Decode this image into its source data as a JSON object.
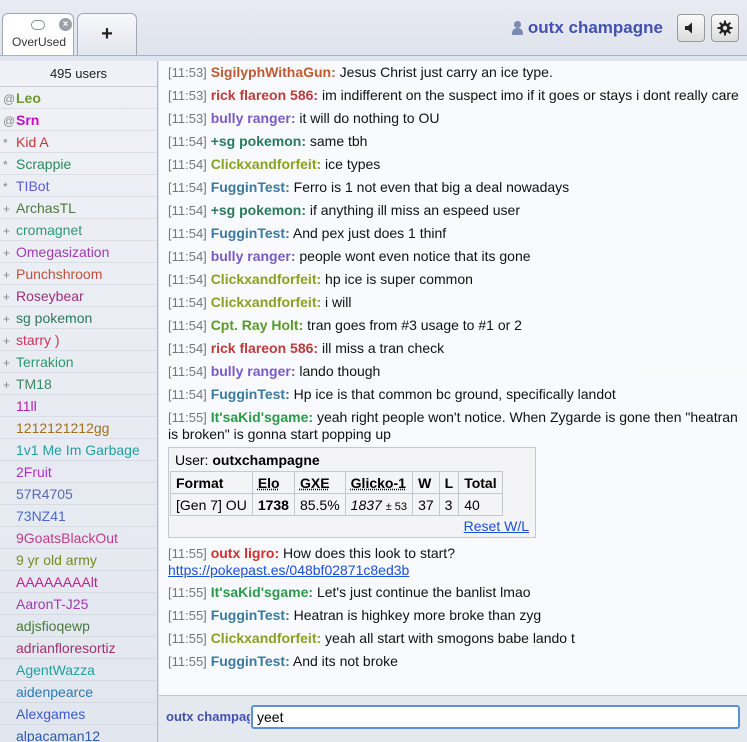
{
  "tabs": {
    "room_label": "OverUsed",
    "close_glyph": "×",
    "new_tab_glyph": "+"
  },
  "userbar": {
    "username": "outx champagne",
    "mute_icon": "speaker-icon",
    "settings_icon": "gear-icon"
  },
  "userlist": {
    "count_label": "495 users",
    "users": [
      {
        "rank": "@",
        "name": "Leo",
        "color": "#6a9a2a",
        "bold": true
      },
      {
        "rank": "@",
        "name": "Srn",
        "color": "#c010c0",
        "bold": true
      },
      {
        "rank": "*",
        "name": "Kid A",
        "color": "#c03838"
      },
      {
        "rank": "*",
        "name": "Scrappie",
        "color": "#2a8a5a"
      },
      {
        "rank": "*",
        "name": "TIBot",
        "color": "#5a5ad8"
      },
      {
        "rank": "+",
        "name": "ArchasTL",
        "color": "#4a7a3a"
      },
      {
        "rank": "+",
        "name": "cromagnet",
        "color": "#2a9a7a"
      },
      {
        "rank": "+",
        "name": "Omegasization",
        "color": "#a03ab0"
      },
      {
        "rank": "+",
        "name": "Punchshroom",
        "color": "#c0503a"
      },
      {
        "rank": "+",
        "name": "Roseybear",
        "color": "#a0307a"
      },
      {
        "rank": "+",
        "name": "sg pokemon",
        "color": "#2a7a5a"
      },
      {
        "rank": "+",
        "name": "starry )",
        "color": "#d0305a"
      },
      {
        "rank": "+",
        "name": "Terrakion",
        "color": "#2a9a6a"
      },
      {
        "rank": "+",
        "name": "TM18",
        "color": "#3a8a5a"
      },
      {
        "rank": "",
        "name": "11ll",
        "color": "#b020b0"
      },
      {
        "rank": "",
        "name": "1212121212gg",
        "color": "#a07020"
      },
      {
        "rank": "",
        "name": "1v1 Me Im Garbage",
        "color": "#20a0a0"
      },
      {
        "rank": "",
        "name": "2Fruit",
        "color": "#b030c0"
      },
      {
        "rank": "",
        "name": "57R4705",
        "color": "#5a6ab0"
      },
      {
        "rank": "",
        "name": "73NZ41",
        "color": "#4a6ad0"
      },
      {
        "rank": "",
        "name": "9GoatsBlackOut",
        "color": "#c03a8a"
      },
      {
        "rank": "",
        "name": "9 yr old army",
        "color": "#7a8a20"
      },
      {
        "rank": "",
        "name": "AAAAAAAAlt",
        "color": "#c02090"
      },
      {
        "rank": "",
        "name": "AaronT-J25",
        "color": "#a03ab0"
      },
      {
        "rank": "",
        "name": "adjsfioqewp",
        "color": "#4a7a3a"
      },
      {
        "rank": "",
        "name": "adrianfloresortiz",
        "color": "#a03070"
      },
      {
        "rank": "",
        "name": "AgentWazza",
        "color": "#20a0a0"
      },
      {
        "rank": "",
        "name": "aidenpearce",
        "color": "#2a7ab0"
      },
      {
        "rank": "",
        "name": "Alexgames",
        "color": "#3a5ad0"
      },
      {
        "rank": "",
        "name": "alpacaman12",
        "color": "#2a5ab0"
      }
    ]
  },
  "messages": [
    {
      "time": "[11:53]",
      "nick": "SigilyphWithaGun:",
      "color": "#c05a30",
      "text": "Jesus Christ just carry an ice type."
    },
    {
      "time": "[11:53]",
      "nick": "rick flareon 586:",
      "color": "#c03a3a",
      "text": "im indifferent on the suspect imo if it goes or stays i dont really care"
    },
    {
      "time": "[11:53]",
      "nick": "bully ranger:",
      "color": "#7a5ac8",
      "text": "it will do nothing to OU"
    },
    {
      "time": "[11:54]",
      "nick": "+sg pokemon:",
      "color": "#2a7a5a",
      "text": "same tbh"
    },
    {
      "time": "[11:54]",
      "nick": "Clickxandforfeit:",
      "color": "#8aa020",
      "text": "ice types"
    },
    {
      "time": "[11:54]",
      "nick": "FugginTest:",
      "color": "#3a7aa0",
      "text": "Ferro is 1 not even that big a deal nowadays"
    },
    {
      "time": "[11:54]",
      "nick": "+sg pokemon:",
      "color": "#2a7a5a",
      "text": "if anything ill miss an espeed user"
    },
    {
      "time": "[11:54]",
      "nick": "FugginTest:",
      "color": "#3a7aa0",
      "text": "And pex just does 1 thinf"
    },
    {
      "time": "[11:54]",
      "nick": "bully ranger:",
      "color": "#7a5ac8",
      "text": "people wont even notice that its gone"
    },
    {
      "time": "[11:54]",
      "nick": "Clickxandforfeit:",
      "color": "#8aa020",
      "text": "hp ice is super common"
    },
    {
      "time": "[11:54]",
      "nick": "Clickxandforfeit:",
      "color": "#8aa020",
      "text": "i will"
    },
    {
      "time": "[11:54]",
      "nick": "Cpt. Ray Holt:",
      "color": "#5a9a2a",
      "text": "tran goes from #3 usage to #1 or 2"
    },
    {
      "time": "[11:54]",
      "nick": "rick flareon 586:",
      "color": "#c03a3a",
      "text": "ill miss a tran check"
    },
    {
      "time": "[11:54]",
      "nick": "bully ranger:",
      "color": "#7a5ac8",
      "text": "lando though"
    },
    {
      "time": "[11:54]",
      "nick": "FugginTest:",
      "color": "#3a7aa0",
      "text": "Hp ice is that common bc ground, specifically landot"
    },
    {
      "time": "[11:55]",
      "nick": "It'saKid'sgame:",
      "color": "#2a9a4a",
      "text": "yeah right people won't notice. When Zygarde is gone then \"heatran is broken\" is gonna start popping up"
    }
  ],
  "rating_box": {
    "user_label": "User:",
    "user_name": "outxchampagne",
    "headers": [
      "Format",
      "Elo",
      "GXE",
      "Glicko-1",
      "W",
      "L",
      "Total"
    ],
    "row": {
      "format": "[Gen 7] OU",
      "elo": "1738",
      "gxe": "85.5%",
      "glicko": "1837",
      "glicko_dev": "± 53",
      "w": "37",
      "l": "3",
      "total": "40"
    },
    "reset_label": "Reset W/L"
  },
  "messages_after": [
    {
      "time": "[11:55]",
      "nick": "outx ligro:",
      "color": "#d03030",
      "text": "How does this look to start?",
      "link": "https://pokepast.es/048bf02871c8ed3b"
    },
    {
      "time": "[11:55]",
      "nick": "It'saKid'sgame:",
      "color": "#2a9a4a",
      "text": "Let's just continue the banlist lmao"
    },
    {
      "time": "[11:55]",
      "nick": "FugginTest:",
      "color": "#3a7aa0",
      "text": "Heatran is highkey more broke than zyg"
    },
    {
      "time": "[11:55]",
      "nick": "Clickxandforfeit:",
      "color": "#8aa020",
      "text": "yeah all start with smogons babe lando t"
    },
    {
      "time": "[11:55]",
      "nick": "FugginTest:",
      "color": "#3a7aa0",
      "text": "And its not broke"
    }
  ],
  "chatbar": {
    "my_nick": "outx champagne",
    "input_value": "yeet"
  }
}
